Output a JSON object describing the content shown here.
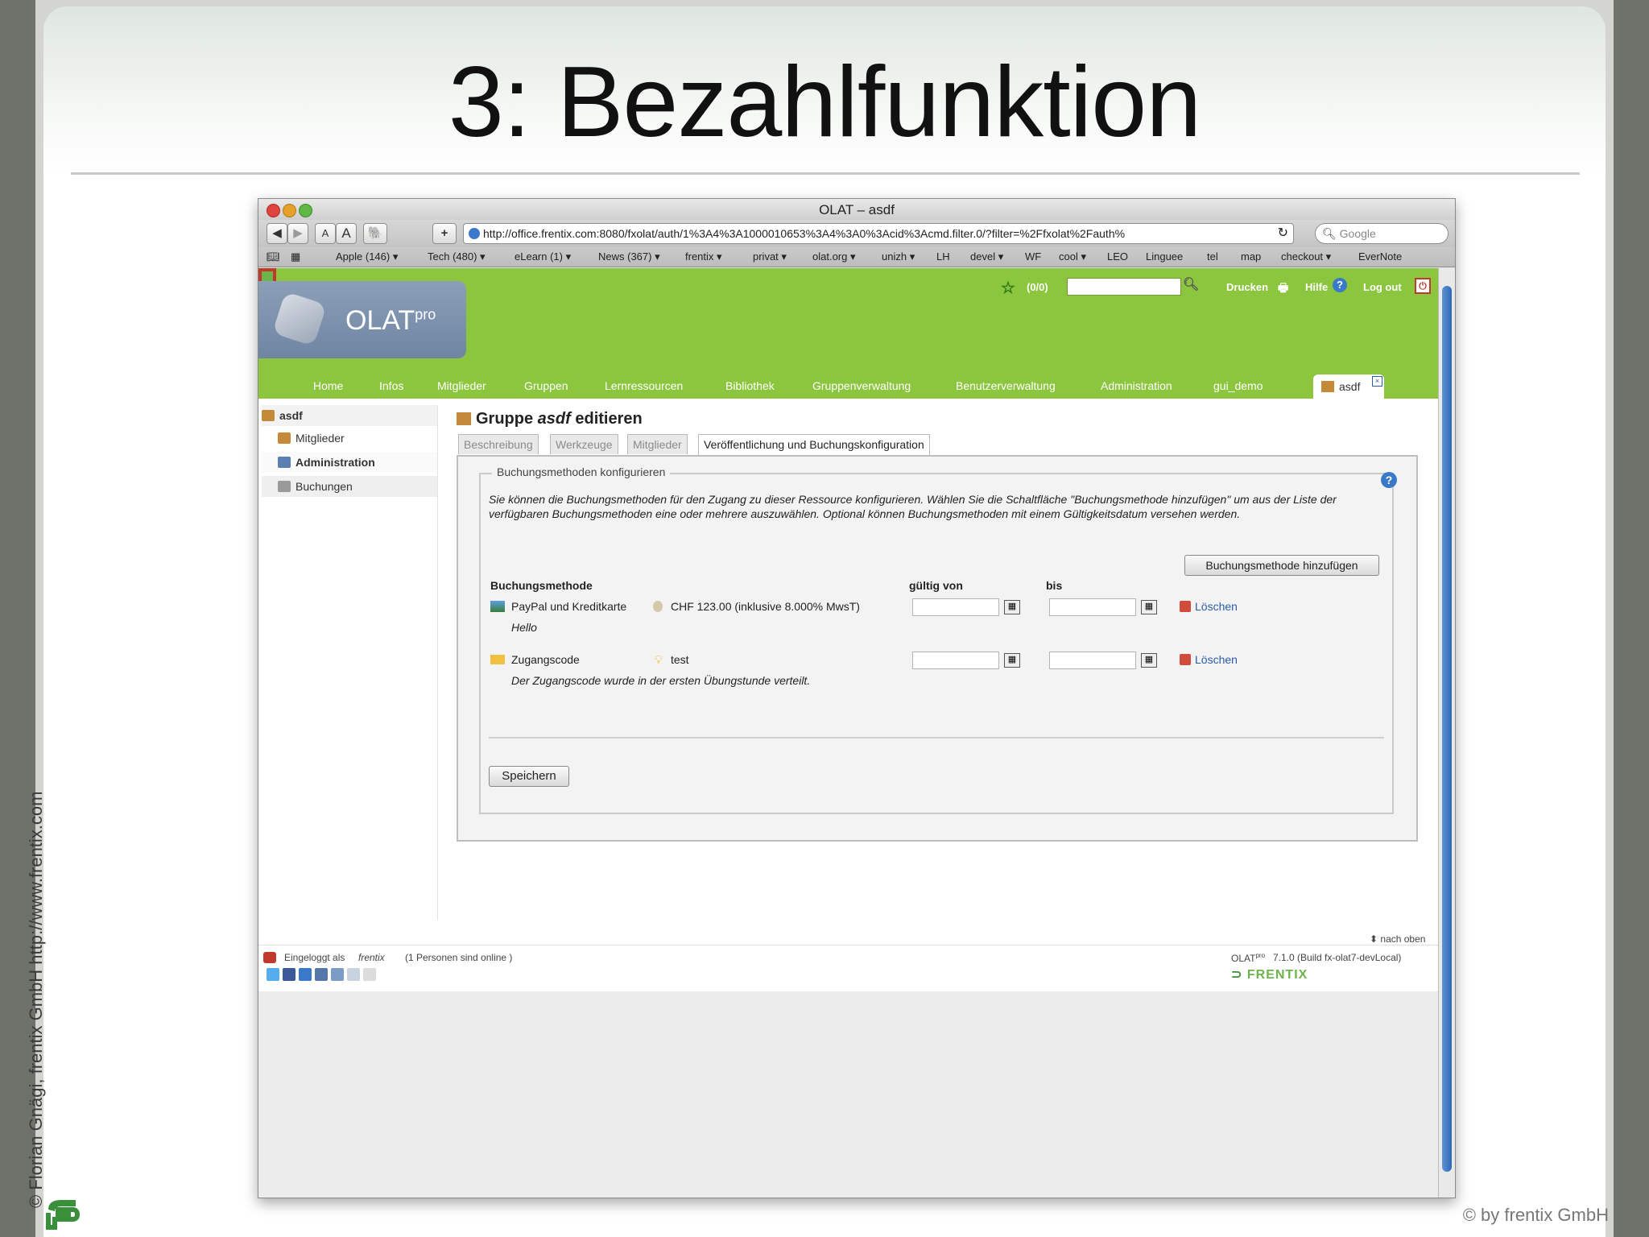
{
  "slide": {
    "title": "3: Bezahlfunktion",
    "side_credit": "© Florian Gnägi, frentix GmbH http://www.frentix.com",
    "copyright": "© by frentix GmbH"
  },
  "browser": {
    "window_title": "OLAT – asdf",
    "url": "http://office.frentix.com:8080/fxolat/auth/1%3A4%3A1000010653%3A4%3A0%3Acid%3Acmd.filter.0/?filter=%2Ffxolat%2Fauth%",
    "search_placeholder": "Google",
    "toolbar": {
      "back": "◀",
      "forward": "▶",
      "smaller": "A",
      "larger": "A",
      "add": "+"
    },
    "bookmarks": [
      "Apple (146) ▾",
      "Tech (480) ▾",
      "eLearn (1) ▾",
      "News (367) ▾",
      "frentix ▾",
      "privat ▾",
      "olat.org ▾",
      "unizh ▾",
      "LH",
      "devel ▾",
      "WF",
      "cool ▾",
      "LEO",
      "Linguee",
      "tel",
      "map",
      "checkout ▾",
      "EverNote"
    ]
  },
  "olat": {
    "logo_text": "OLAT",
    "logo_sup": "pro",
    "bookmark_count": "(0/0)",
    "print_label": "Drucken",
    "help_label": "Hilfe",
    "logout_label": "Log out",
    "nav": [
      "Home",
      "Infos",
      "Mitglieder",
      "Gruppen",
      "Lernressourcen",
      "Bibliothek",
      "Gruppenverwaltung",
      "Benutzerverwaltung",
      "Administration",
      "gui_demo"
    ],
    "active_tab": "asdf"
  },
  "leftmenu": {
    "items": [
      "asdf",
      "Mitglieder",
      "Administration",
      "Buchungen"
    ]
  },
  "main": {
    "title_prefix": "Gruppe ",
    "title_name": "asdf",
    "title_suffix": " editieren",
    "tabs": [
      "Beschreibung",
      "Werkzeuge",
      "Mitglieder",
      "Veröffentlichung und Buchungskonfiguration"
    ],
    "legend": "Buchungsmethoden konfigurieren",
    "description": "Sie können die Buchungsmethoden für den Zugang zu dieser Ressource konfigurieren. Wählen Sie die Schaltfläche \"Buchungsmethode hinzufügen\" um aus der Liste der verfügbaren Buchungsmethoden eine oder mehrere auszuwählen. Optional können Buchungsmethoden mit einem Gültigkeitsdatum versehen werden.",
    "add_button": "Buchungsmethode hinzufügen",
    "col_method": "Buchungsmethode",
    "col_valid_from": "gültig von",
    "col_until": "bis",
    "rows": [
      {
        "method": "PayPal und Kreditkarte",
        "price": "CHF 123.00 (inklusive 8.000% MwsT)",
        "note": "Hello",
        "delete": "Löschen"
      },
      {
        "method": "Zugangscode",
        "price": "test",
        "note": "Der Zugangscode wurde in der ersten Übungstunde verteilt.",
        "delete": "Löschen"
      }
    ],
    "save_button": "Speichern"
  },
  "footer": {
    "logged_in": "Eingeloggt als",
    "user": "frentix",
    "online": "(1 Personen sind online )",
    "to_top": "nach oben",
    "version": "7.1.0 (Build fx-olat7-devLocal)",
    "olat_pro": "OLAT",
    "olat_pro_sup": "pro",
    "brand": "FRENTIX"
  }
}
